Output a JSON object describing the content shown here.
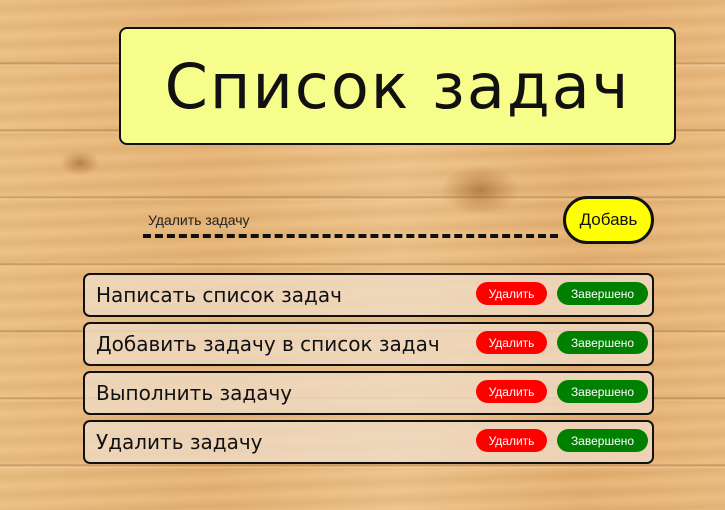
{
  "header": {
    "title": "Список задач"
  },
  "form": {
    "input_placeholder": "Удалить задачу",
    "add_label": "Добавь"
  },
  "tasks": [
    {
      "text": "Написать список задач",
      "delete_label": "Удалить",
      "done_label": "Завершено"
    },
    {
      "text": "Добавить задачу в список задач",
      "delete_label": "Удалить",
      "done_label": "Завершено"
    },
    {
      "text": "Выполнить задачу",
      "delete_label": "Удалить",
      "done_label": "Завершено"
    },
    {
      "text": "Удалить задачу",
      "delete_label": "Удалить",
      "done_label": "Завершено"
    }
  ],
  "colors": {
    "title_background": "#f7fd8b",
    "add_button": "#ffff00",
    "delete_button": "#ff0000",
    "done_button": "#008000"
  }
}
